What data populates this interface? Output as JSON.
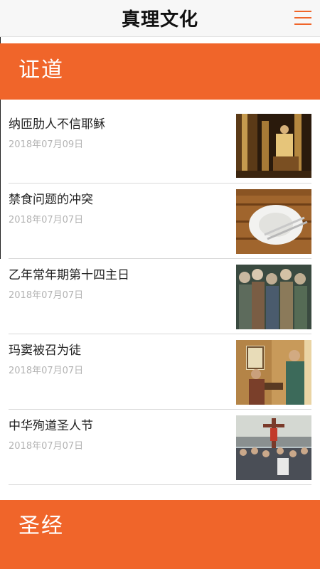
{
  "header": {
    "title": "真理文化",
    "menu_icon": "hamburger-menu-icon",
    "accent_color": "#f0652a"
  },
  "sections": [
    {
      "label": "证道",
      "items": [
        {
          "title": "纳匝肋人不信耶稣",
          "date": "2018年07月09日",
          "thumb_icon": "temple-painting"
        },
        {
          "title": "禁食问题的冲突",
          "date": "2018年07月07日",
          "thumb_icon": "empty-plate-fork-knife"
        },
        {
          "title": "乙年常年期第十四主日",
          "date": "2018年07月07日",
          "thumb_icon": "crowd-painting"
        },
        {
          "title": "玛窦被召为徒",
          "date": "2018年07月07日",
          "thumb_icon": "calling-of-matthew-painting"
        },
        {
          "title": "中华殉道圣人节",
          "date": "2018年07月07日",
          "thumb_icon": "martyrs-cross-painting"
        }
      ]
    },
    {
      "label": "圣经"
    }
  ]
}
